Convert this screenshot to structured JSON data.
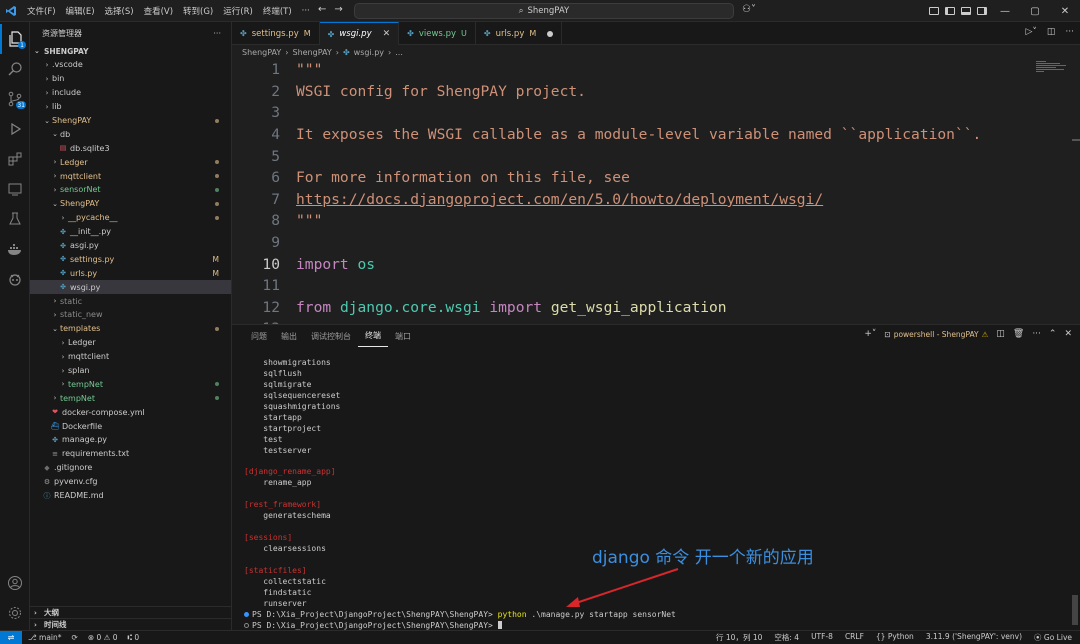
{
  "titlebar": {
    "logo": "VS",
    "menu": [
      "文件(F)",
      "编辑(E)",
      "选择(S)",
      "查看(V)",
      "转到(G)",
      "运行(R)",
      "终端(T)",
      "···"
    ],
    "search": "ShengPAY",
    "window": {
      "minimize": "—",
      "restore": "▢",
      "close": "✕"
    }
  },
  "activity": {
    "scm_badge": "31",
    "explorer_badge": "1"
  },
  "sidebar": {
    "title": "资源管理器",
    "more": "···",
    "root": "SHENGPAY",
    "items": [
      {
        "label": ".vscode",
        "kind": "folder",
        "depth": 1,
        "open": false
      },
      {
        "label": "bin",
        "kind": "folder",
        "depth": 1,
        "open": false
      },
      {
        "label": "include",
        "kind": "folder",
        "depth": 1,
        "open": false
      },
      {
        "label": "lib",
        "kind": "folder",
        "depth": 1,
        "open": false
      },
      {
        "label": "ShengPAY",
        "kind": "folder",
        "depth": 1,
        "open": true,
        "color": "#e2c08d",
        "dot": true
      },
      {
        "label": "db",
        "kind": "folder",
        "depth": 2,
        "open": true
      },
      {
        "label": "db.sqlite3",
        "kind": "db",
        "depth": 3
      },
      {
        "label": "Ledger",
        "kind": "folder",
        "depth": 2,
        "open": false,
        "color": "#e2c08d",
        "dot": true
      },
      {
        "label": "mqttclient",
        "kind": "folder",
        "depth": 2,
        "open": false,
        "color": "#e2c08d",
        "dot": true
      },
      {
        "label": "sensorNet",
        "kind": "folder",
        "depth": 2,
        "open": false,
        "color": "#73c991",
        "dot": true
      },
      {
        "label": "ShengPAY",
        "kind": "folder",
        "depth": 2,
        "open": true,
        "color": "#e2c08d",
        "dot": true
      },
      {
        "label": "__pycache__",
        "kind": "folder",
        "depth": 3,
        "open": false,
        "color": "#e2c08d",
        "dot": true
      },
      {
        "label": "__init__.py",
        "kind": "py",
        "depth": 3
      },
      {
        "label": "asgi.py",
        "kind": "py",
        "depth": 3
      },
      {
        "label": "settings.py",
        "kind": "py",
        "depth": 3,
        "color": "#e2c08d",
        "mark": "M"
      },
      {
        "label": "urls.py",
        "kind": "py",
        "depth": 3,
        "color": "#e2c08d",
        "mark": "M"
      },
      {
        "label": "wsgi.py",
        "kind": "py",
        "depth": 3,
        "selected": true
      },
      {
        "label": "static",
        "kind": "folder",
        "depth": 2,
        "open": false,
        "color": "#8b8b8b"
      },
      {
        "label": "static_new",
        "kind": "folder",
        "depth": 2,
        "open": false,
        "color": "#8b8b8b"
      },
      {
        "label": "templates",
        "kind": "folder",
        "depth": 2,
        "open": true,
        "color": "#e2c08d",
        "dot": true
      },
      {
        "label": "Ledger",
        "kind": "folder",
        "depth": 3,
        "open": false
      },
      {
        "label": "mqttclient",
        "kind": "folder",
        "depth": 3,
        "open": false
      },
      {
        "label": "splan",
        "kind": "folder",
        "depth": 3,
        "open": false
      },
      {
        "label": "tempNet",
        "kind": "folder",
        "depth": 3,
        "open": false,
        "color": "#73c991",
        "dot": true
      },
      {
        "label": "tempNet",
        "kind": "folder",
        "depth": 2,
        "open": false,
        "color": "#73c991",
        "dot": true
      },
      {
        "label": "docker-compose.yml",
        "kind": "yml",
        "depth": 2
      },
      {
        "label": "Dockerfile",
        "kind": "docker",
        "depth": 2
      },
      {
        "label": "manage.py",
        "kind": "py",
        "depth": 2
      },
      {
        "label": "requirements.txt",
        "kind": "txt",
        "depth": 2
      },
      {
        "label": ".gitignore",
        "kind": "git",
        "depth": 1
      },
      {
        "label": "pyvenv.cfg",
        "kind": "cfg",
        "depth": 1
      },
      {
        "label": "README.md",
        "kind": "info",
        "depth": 1
      }
    ],
    "outline": "大纲",
    "timeline": "时间线"
  },
  "tabs": [
    {
      "label": "settings.py",
      "status": "M",
      "status_kind": "mod"
    },
    {
      "label": "wsgi.py",
      "active": true,
      "close": "✕"
    },
    {
      "label": "views.py",
      "status": "U",
      "status_kind": "untracked"
    },
    {
      "label": "urls.py",
      "status": "M",
      "status_kind": "mod",
      "unsaved": true
    }
  ],
  "breadcrumb": [
    "ShengPAY",
    "ShengPAY",
    "wsgi.py",
    "..."
  ],
  "editor": {
    "current_line": 10,
    "lines": [
      {
        "n": "1",
        "parts": [
          {
            "t": "\"\"\"",
            "c": "str"
          }
        ]
      },
      {
        "n": "2",
        "parts": [
          {
            "t": "WSGI config for ShengPAY project.",
            "c": "str"
          }
        ]
      },
      {
        "n": "3",
        "parts": []
      },
      {
        "n": "4",
        "parts": [
          {
            "t": "It exposes the WSGI callable as a module-level variable named ``application``.",
            "c": "str"
          }
        ]
      },
      {
        "n": "5",
        "parts": []
      },
      {
        "n": "6",
        "parts": [
          {
            "t": "For more information on this file, see",
            "c": "str"
          }
        ]
      },
      {
        "n": "7",
        "parts": [
          {
            "t": "https://docs.djangoproject.com/en/5.0/howto/deployment/wsgi/",
            "c": "str url"
          }
        ]
      },
      {
        "n": "8",
        "parts": [
          {
            "t": "\"\"\"",
            "c": "str"
          }
        ]
      },
      {
        "n": "9",
        "parts": []
      },
      {
        "n": "10",
        "parts": [
          {
            "t": "import",
            "c": "kw"
          },
          {
            "t": " ",
            "c": ""
          },
          {
            "t": "os",
            "c": "mod-name"
          }
        ]
      },
      {
        "n": "11",
        "parts": []
      },
      {
        "n": "12",
        "parts": [
          {
            "t": "from",
            "c": "kw"
          },
          {
            "t": " ",
            "c": ""
          },
          {
            "t": "django.core.wsgi",
            "c": "mod-name"
          },
          {
            "t": " ",
            "c": ""
          },
          {
            "t": "import",
            "c": "kw"
          },
          {
            "t": " ",
            "c": ""
          },
          {
            "t": "get_wsgi_application",
            "c": "fn"
          }
        ]
      },
      {
        "n": "13",
        "parts": []
      }
    ]
  },
  "panel": {
    "tabs": [
      "问题",
      "输出",
      "调试控制台",
      "终端",
      "端口"
    ],
    "active_tab": "终端",
    "terminal_name": "powershell - ShengPAY",
    "terminal_lines": [
      {
        "t": "    showmigrations"
      },
      {
        "t": "    sqlflush"
      },
      {
        "t": "    sqlmigrate"
      },
      {
        "t": "    sqlsequencereset"
      },
      {
        "t": "    squashmigrations"
      },
      {
        "t": "    startapp"
      },
      {
        "t": "    startproject"
      },
      {
        "t": "    test"
      },
      {
        "t": "    testserver"
      },
      {
        "t": ""
      },
      {
        "t": "[django_rename_app]",
        "c": "t-cat"
      },
      {
        "t": "    rename_app"
      },
      {
        "t": ""
      },
      {
        "t": "[rest_framework]",
        "c": "t-cat"
      },
      {
        "t": "    generateschema"
      },
      {
        "t": ""
      },
      {
        "t": "[sessions]",
        "c": "t-cat"
      },
      {
        "t": "    clearsessions"
      },
      {
        "t": ""
      },
      {
        "t": "[staticfiles]",
        "c": "t-cat"
      },
      {
        "t": "    collectstatic"
      },
      {
        "t": "    findstatic"
      },
      {
        "t": "    runserver"
      }
    ],
    "prompt1": "PS D:\\Xia_Project\\DjangoProject\\ShengPAY\\ShengPAY>",
    "cmd1_exe": "python",
    "cmd1_args": " .\\manage.py startapp sensorNet",
    "prompt2": "PS D:\\Xia_Project\\DjangoProject\\ShengPAY\\ShengPAY>",
    "annotation": "django 命令 开一个新的应用"
  },
  "status": {
    "remote": "⇌",
    "branch": "⎇ main*",
    "sync": "⟳",
    "problems": "⊗ 0 ⚠ 0",
    "ports": "⑆ 0",
    "position": "行 10，列 10",
    "spaces": "空格: 4",
    "encoding": "UTF-8",
    "eol": "CRLF",
    "language": "{} Python",
    "interpreter": "3.11.9 ('ShengPAY': venv)",
    "golive": "⦿ Go Live"
  }
}
